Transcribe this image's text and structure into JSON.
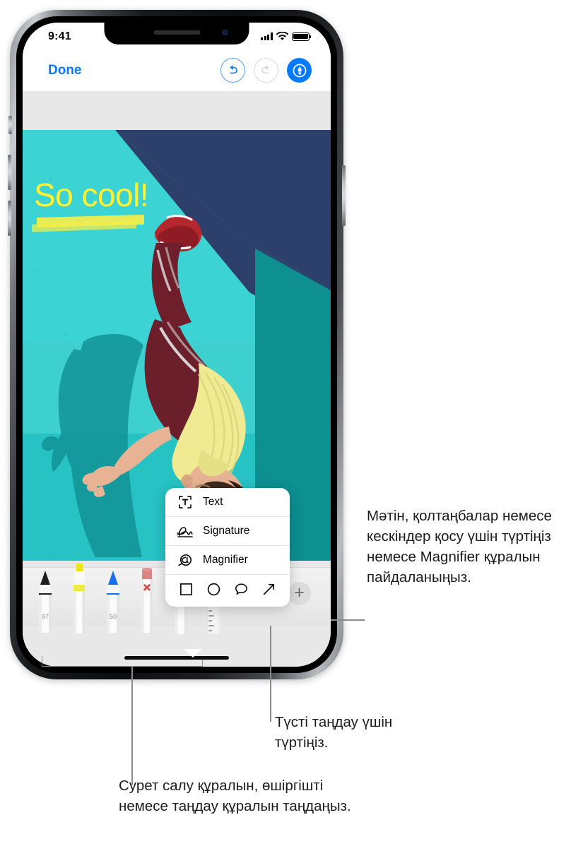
{
  "status_bar": {
    "time": "9:41",
    "signal_icon": "cellular-bars-icon",
    "wifi_icon": "wifi-icon",
    "battery_icon": "battery-icon"
  },
  "nav_bar": {
    "done_label": "Done",
    "undo_icon": "undo-arrow-icon",
    "redo_icon": "redo-arrow-icon",
    "markup_icon": "markup-pen-icon",
    "accent_color": "#067aff",
    "disabled_color": "#d5d7da"
  },
  "photo": {
    "annotation_text": "So cool!",
    "annotation_color": "#fbf236",
    "highlight_color": "#f4ee4a",
    "wall_teal": "#3bd3d3",
    "wall_navy": "#2d3f6b",
    "wall_dark_teal": "#0d8a8a",
    "description": "person doing a handstand flip against a teal and navy painted wall with shadow"
  },
  "popup_menu": {
    "items": [
      {
        "label": "Text",
        "icon": "text-box-icon"
      },
      {
        "label": "Signature",
        "icon": "signature-icon"
      },
      {
        "label": "Magnifier",
        "icon": "magnifier-icon"
      }
    ],
    "shapes": [
      {
        "name": "square-shape-icon"
      },
      {
        "name": "circle-shape-icon"
      },
      {
        "name": "speech-bubble-shape-icon"
      },
      {
        "name": "arrow-shape-icon"
      }
    ]
  },
  "toolbar": {
    "tools": [
      {
        "name": "pen-tool",
        "value": "97",
        "tip_color": "#2b2b2b"
      },
      {
        "name": "highlighter-tool",
        "value": "",
        "tip_color": "#f2e314"
      },
      {
        "name": "marker-tool",
        "value": "50",
        "tip_color": "#1a6df0"
      },
      {
        "name": "eraser-tool",
        "value": "",
        "tip_color": "#d98585"
      },
      {
        "name": "lasso-tool",
        "value": "",
        "tip_color": "#b8b8b8"
      },
      {
        "name": "ruler-tool",
        "value": "",
        "tip_color": "#e9e9e9"
      }
    ],
    "color_picker_swatch": "#f2e314",
    "add_button_label": "+"
  },
  "callouts": {
    "markup_tools": "Мәтін, қолтаңбалар немесе кескіндер қосу үшін түртіңіз немесе Magnifier құралын пайдаланыңыз.",
    "color_picker": "Түсті таңдау үшін түртіңіз.",
    "drawing_tools": "Сурет салу құралын, өшіргішті немесе таңдау құралын таңдаңыз."
  }
}
